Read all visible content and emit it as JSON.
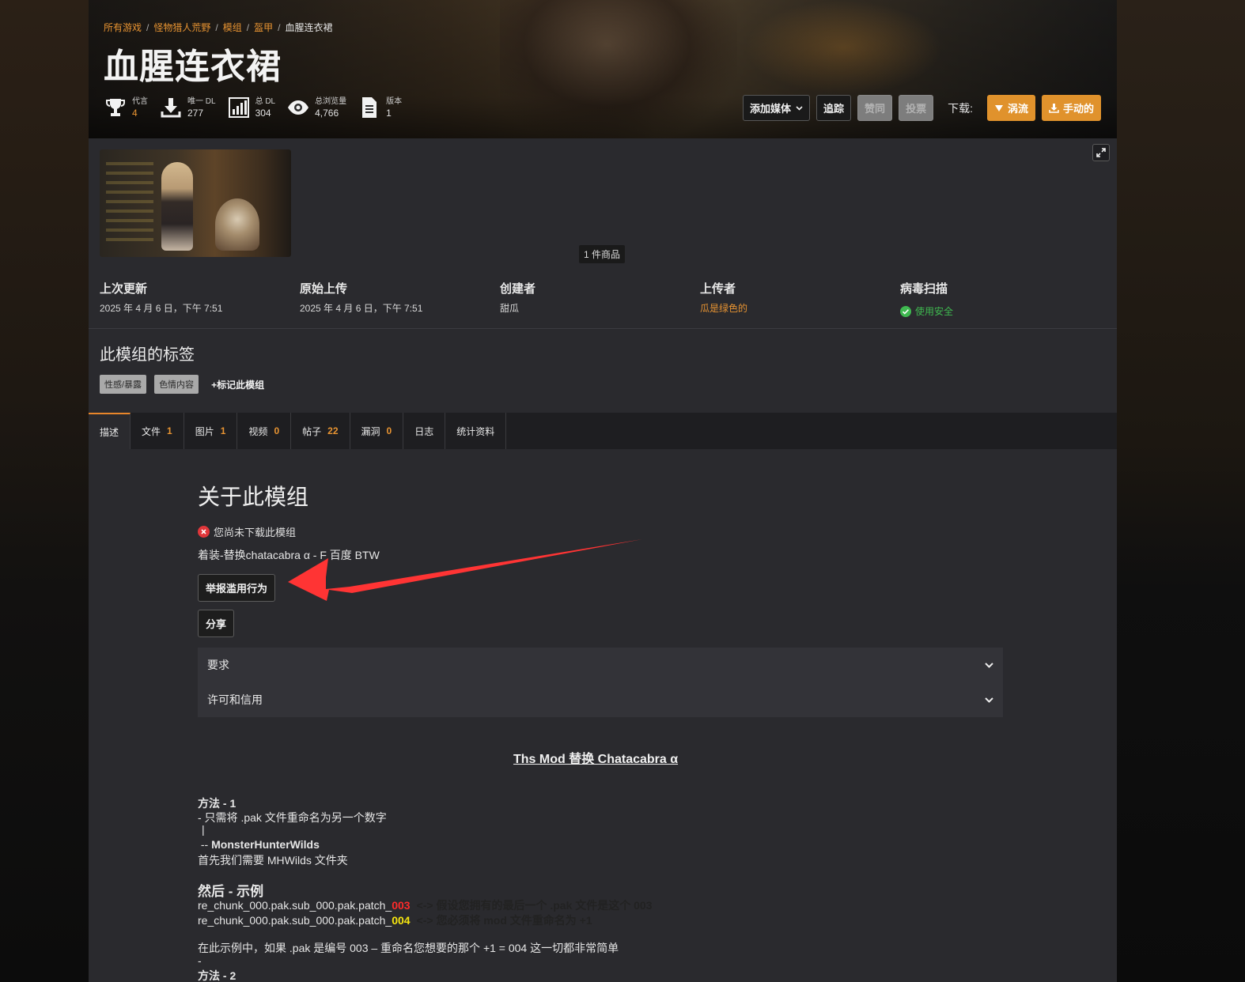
{
  "breadcrumb": {
    "items": [
      "所有游戏",
      "怪物猎人荒野",
      "模组",
      "盔甲"
    ],
    "current": "血腥连衣裙"
  },
  "title": "血腥连衣裙",
  "stats": [
    {
      "icon": "trophy-icon",
      "label": "代言",
      "value": "4"
    },
    {
      "icon": "download-icon",
      "label": "唯一 DL",
      "value": "277"
    },
    {
      "icon": "bar-chart-icon",
      "label": "总 DL",
      "value": "304"
    },
    {
      "icon": "eye-icon",
      "label": "总浏览量",
      "value": "4,766"
    },
    {
      "icon": "document-icon",
      "label": "版本",
      "value": "1"
    }
  ],
  "actions": {
    "add_media": "添加媒体",
    "track": "追踪",
    "endorse": "赞同",
    "vote": "投票",
    "download_label": "下载:",
    "vortex": "涡流",
    "manual": "手动的"
  },
  "gallery": {
    "counter": "1 件商品"
  },
  "meta": {
    "last_updated": {
      "label": "上次更新",
      "value": "2025 年 4 月 6 日，下午 7:51"
    },
    "original_upload": {
      "label": "原始上传",
      "value": "2025 年 4 月 6 日，下午 7:51"
    },
    "creator": {
      "label": "创建者",
      "value": "甜瓜"
    },
    "uploader": {
      "label": "上传者",
      "value": "瓜是绿色的"
    },
    "virus_scan": {
      "label": "病毒扫描",
      "value": "使用安全"
    }
  },
  "tags": {
    "title": "此模组的标签",
    "items": [
      "性感/暴露",
      "色情内容"
    ],
    "add": "标记此模组"
  },
  "tabs": [
    {
      "label": "描述",
      "count": ""
    },
    {
      "label": "文件",
      "count": "1"
    },
    {
      "label": "图片",
      "count": "1"
    },
    {
      "label": "视频",
      "count": "0"
    },
    {
      "label": "帖子",
      "count": "22"
    },
    {
      "label": "漏洞",
      "count": "0"
    },
    {
      "label": "日志",
      "count": ""
    },
    {
      "label": "统计资料",
      "count": ""
    }
  ],
  "about": {
    "title": "关于此模组",
    "not_downloaded": "您尚未下载此模组",
    "summary": "着装-替换chatacabra α - F 百度 BTW",
    "report": "举报滥用行为",
    "share": "分享",
    "requirements": "要求",
    "permissions": "许可和信用"
  },
  "description": {
    "heading": "Ths Mod 替换 Chatacabra α",
    "method1_title": "方法 - 1",
    "method1_line": "- 只需将 .pak 文件重命名为另一个数字",
    "pipe": "|",
    "folder_prefix": " -- ",
    "folder_name": "MonsterHunterWilds",
    "folder_line": "首先我们需要 MHWilds 文件夹",
    "example_title": "然后 - 示例",
    "ex1_prefix": "re_chunk_000.pak.sub_000.pak.patch_",
    "ex1_num": "003",
    "ex1_note": "<-> 假设您拥有的最后一个 .pak 文件是这个 003",
    "ex2_prefix": "re_chunk_000.pak.sub_000.pak.patch_",
    "ex2_num": "004",
    "ex2_note": "<-> 您必须将 mod 文件重命名为 +1",
    "explain": "在此示例中，如果 .pak 是编号 003 – 重命名您想要的那个 +1 = 004 这一切都非常简单",
    "dash": "-",
    "method2_title": "方法 - 2"
  },
  "colors": {
    "accent": "#e0922c",
    "link": "#e89432",
    "safe": "#3fb950",
    "arrow": "#ff3434"
  }
}
